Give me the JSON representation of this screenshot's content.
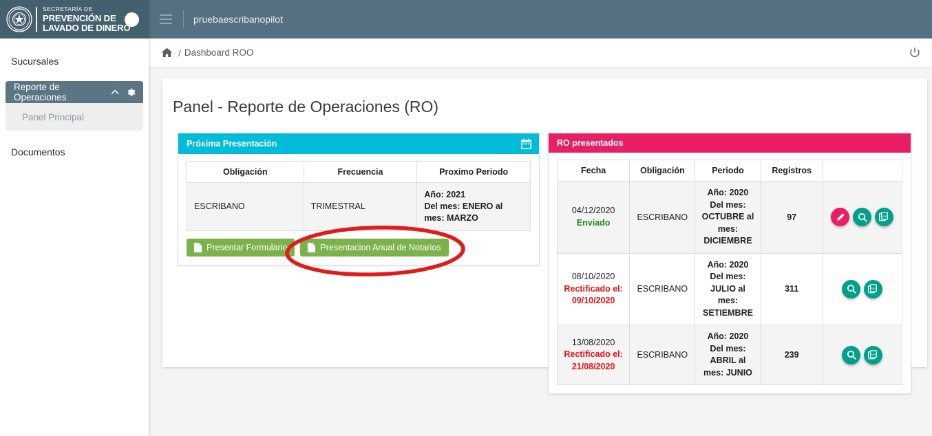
{
  "brand": {
    "line1": "SECRETARÍA DE",
    "line2": "PREVENCIÓN DE",
    "line3": "LAVADO DE DINERO",
    "seal_icon": "paraguay-seal-icon",
    "avatar_icon": "avatar-circle-icon"
  },
  "sidebar": {
    "items": [
      {
        "label": "Sucursales",
        "name": "sidebar-item-sucursales"
      },
      {
        "label": "Reporte de Operaciones",
        "name": "sidebar-item-reporte-de-operaciones",
        "chevron_icon": "chevron-up-icon",
        "gear_icon": "gear-icon",
        "children": [
          {
            "label": "Panel Principal",
            "name": "sidebar-subitem-panel-principal"
          }
        ]
      },
      {
        "label": "Documentos",
        "name": "sidebar-item-documentos"
      }
    ]
  },
  "topbar": {
    "menu_icon": "hamburger-menu-icon",
    "user": "pruebaescribanopilot"
  },
  "breadcrumb": {
    "home_icon": "home-icon",
    "separator": "/",
    "current": "Dashboard ROO",
    "logout_icon": "power-logout-icon"
  },
  "main": {
    "title": "Panel - Reporte de Operaciones (RO)"
  },
  "next_presentation": {
    "header": "Próxima Presentación",
    "header_color": "#00bcd8",
    "calendar_icon": "calendar-icon",
    "columns": [
      "Obligación",
      "Frecuencia",
      "Proximo Periodo"
    ],
    "rows": [
      {
        "obligacion": "ESCRIBANO",
        "frecuencia": "TRIMESTRAL",
        "periodo_anio": "Año: 2021",
        "periodo_rango": "Del mes: ENERO al mes: MARZO"
      }
    ],
    "buttons": [
      {
        "label": "Presentar Formulario",
        "name": "presentar-formulario-button",
        "icon": "document-icon"
      },
      {
        "label": "Presentacion Anual de Notarios",
        "name": "presentacion-anual-de-notarios-button",
        "icon": "document-icon"
      }
    ]
  },
  "submitted_reports": {
    "header": "RO presentados",
    "header_color": "#e91e63",
    "columns": [
      "Fecha",
      "Obligación",
      "Periodo",
      "Registros",
      ""
    ],
    "rows": [
      {
        "fecha": "04/12/2020",
        "estado": "Enviado",
        "estado_tipo": "enviado",
        "obligacion": "ESCRIBANO",
        "periodo_anio": "Año: 2020",
        "periodo_rango": "Del mes: OCTUBRE al mes: DICIEMBRE",
        "registros": "97",
        "actions": [
          "edit-icon",
          "search-icon",
          "pdf-icon"
        ]
      },
      {
        "fecha": "08/10/2020",
        "estado": "Rectificado el: 09/10/2020",
        "estado_tipo": "rectificado",
        "obligacion": "ESCRIBANO",
        "periodo_anio": "Año: 2020",
        "periodo_rango": "Del mes: JULIO al mes: SETIEMBRE",
        "registros": "311",
        "actions": [
          "search-icon",
          "pdf-icon"
        ]
      },
      {
        "fecha": "13/08/2020",
        "estado": "Rectificado el: 21/08/2020",
        "estado_tipo": "rectificado",
        "obligacion": "ESCRIBANO",
        "periodo_anio": "Año: 2020",
        "periodo_rango": "Del mes: ABRIL al mes: JUNIO",
        "registros": "239",
        "actions": [
          "search-icon",
          "pdf-icon"
        ]
      }
    ]
  },
  "annotation": {
    "shape": "red-ellipse-highlight",
    "color": "#e01b1b",
    "target": "presentacion-anual-de-notarios-button"
  },
  "colors": {
    "sidebar_header": "#44606e",
    "topbar": "#547081",
    "nav_active": "#5b7584",
    "cyan": "#00bcd8",
    "pink": "#e91e63",
    "green_button": "#7bb24c",
    "orange_text": "#f5a623",
    "teal_action": "#00a08a",
    "page_bg": "#f4f4f4"
  }
}
